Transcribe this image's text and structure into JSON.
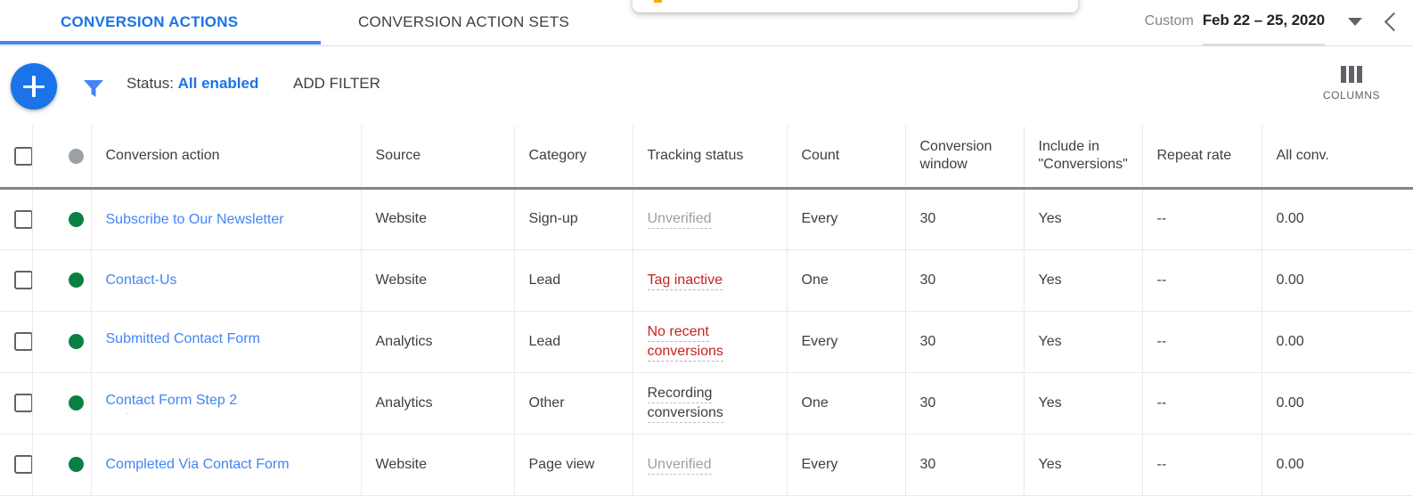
{
  "tabs": [
    {
      "label": "CONVERSION ACTIONS",
      "active": true
    },
    {
      "label": "CONVERSION ACTION SETS",
      "active": false
    }
  ],
  "date_range": {
    "preset_label": "Custom",
    "value": "Feb 22 – 25, 2020",
    "dropdown_icon": "chevron-down-icon",
    "prev_icon": "chevron-left-icon"
  },
  "toolbar": {
    "add_button_icon": "plus-icon",
    "filter_icon": "funnel-icon",
    "status_prefix": "Status:",
    "status_value": "All enabled",
    "add_filter_label": "ADD FILTER",
    "columns_label": "COLUMNS",
    "columns_icon": "columns-icon"
  },
  "table": {
    "headers": [
      "Conversion action",
      "Source",
      "Category",
      "Tracking status",
      "Count",
      "Conversion window",
      "Include in \"Conversions\"",
      "Repeat rate",
      "All conv."
    ],
    "rows": [
      {
        "status_dot": "enabled",
        "name": "Subscribe to Our Newsletter",
        "name_sub": "",
        "source": "Website",
        "category": "Sign-up",
        "tracking_status": "Unverified",
        "tracking_state": "unverified",
        "count": "Every",
        "conversion_window": "30",
        "include_in_conversions": "Yes",
        "repeat_rate": "--",
        "all_conv": "0.00"
      },
      {
        "status_dot": "enabled",
        "name": "Contact-Us",
        "name_sub": "",
        "source": "Website",
        "category": "Lead",
        "tracking_status": "Tag inactive",
        "tracking_state": "error",
        "count": "One",
        "conversion_window": "30",
        "include_in_conversions": "Yes",
        "repeat_rate": "--",
        "all_conv": "0.00"
      },
      {
        "status_dot": "enabled",
        "name": "Submitted Contact Form",
        "name_sub": "clipped",
        "source": "Analytics",
        "category": "Lead",
        "tracking_status": "No recent conversions",
        "tracking_state": "error",
        "count": "Every",
        "conversion_window": "30",
        "include_in_conversions": "Yes",
        "repeat_rate": "--",
        "all_conv": "0.00"
      },
      {
        "status_dot": "enabled",
        "name": "Contact Form Step 2",
        "name_sub": "clipped",
        "source": "Analytics",
        "category": "Other",
        "tracking_status": "Recording conversions",
        "tracking_state": "ok",
        "count": "One",
        "conversion_window": "30",
        "include_in_conversions": "Yes",
        "repeat_rate": "--",
        "all_conv": "0.00"
      },
      {
        "status_dot": "enabled",
        "name": "Completed Via Contact Form",
        "name_sub": "",
        "source": "Website",
        "category": "Page view",
        "tracking_status": "Unverified",
        "tracking_state": "unverified",
        "count": "Every",
        "conversion_window": "30",
        "include_in_conversions": "Yes",
        "repeat_rate": "--",
        "all_conv": "0.00"
      }
    ]
  },
  "colors": {
    "accent_blue": "#1a73e8",
    "link_blue": "#4285f4",
    "status_green": "#0a8043",
    "status_gray": "#9aa0a6",
    "error_red": "#c5221f"
  }
}
